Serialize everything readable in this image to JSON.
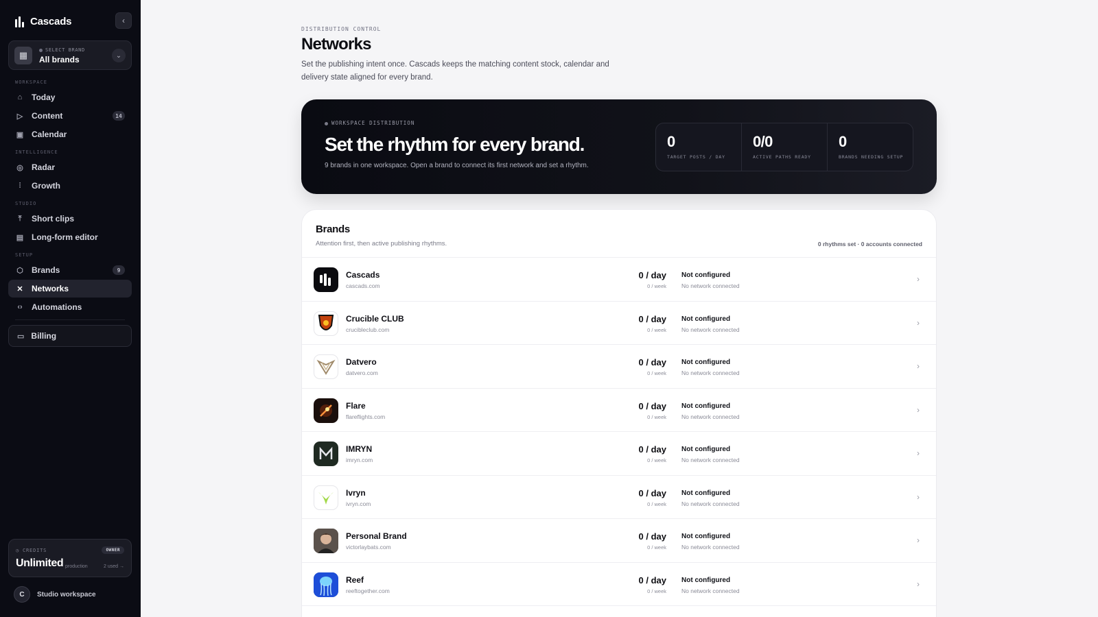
{
  "app": {
    "name": "Cascads"
  },
  "sidebar": {
    "collapse_icon": "chevron-left-icon",
    "brand_select": {
      "label": "SELECT BRAND",
      "value": "All brands"
    },
    "sections": {
      "workspace": "WORKSPACE",
      "intelligence": "INTELLIGENCE",
      "studio": "STUDIO",
      "setup": "SETUP"
    },
    "items": [
      {
        "label": "Today",
        "icon": "home-icon"
      },
      {
        "label": "Content",
        "icon": "play-square-icon",
        "badge": "14"
      },
      {
        "label": "Calendar",
        "icon": "calendar-icon"
      },
      {
        "label": "Radar",
        "icon": "radar-icon"
      },
      {
        "label": "Growth",
        "icon": "chart-icon"
      },
      {
        "label": "Short clips",
        "icon": "upload-icon"
      },
      {
        "label": "Long-form editor",
        "icon": "film-icon"
      },
      {
        "label": "Brands",
        "icon": "box-icon",
        "badge": "9"
      },
      {
        "label": "Networks",
        "icon": "network-icon",
        "active": true
      },
      {
        "label": "Automations",
        "icon": "code-icon"
      }
    ],
    "billing": {
      "label": "Billing",
      "icon": "card-icon"
    },
    "credits": {
      "label": "CREDITS",
      "role": "OWNER",
      "value": "Unlimited",
      "env": "production",
      "used": "2 used →"
    },
    "workspace": {
      "initial": "C",
      "name": "Studio workspace"
    }
  },
  "header": {
    "eyebrow": "DISTRIBUTION CONTROL",
    "title": "Networks",
    "description": "Set the publishing intent once. Cascads keeps the matching content stock, calendar and delivery state aligned for every brand."
  },
  "hero": {
    "eyebrow": "WORKSPACE DISTRIBUTION",
    "title": "Set the rhythm for every brand.",
    "subtitle": "9 brands in one workspace. Open a brand to connect its first network and set a rhythm.",
    "stats": [
      {
        "value": "0",
        "label": "TARGET POSTS / DAY"
      },
      {
        "value": "0/0",
        "label": "ACTIVE PATHS READY"
      },
      {
        "value": "0",
        "label": "BRANDS NEEDING SETUP"
      }
    ]
  },
  "brands": {
    "title": "Brands",
    "subtitle": "Attention first, then active publishing rhythms.",
    "summary": "0 rhythms set · 0 accounts connected",
    "rows": [
      {
        "name": "Cascads",
        "domain": "cascads.com",
        "rate": "0 / day",
        "week": "0 / week",
        "status": "Not configured",
        "network": "No network connected",
        "logo_color": "#0b0b0f"
      },
      {
        "name": "Crucible CLUB",
        "domain": "crucibleclub.com",
        "rate": "0 / day",
        "week": "0 / week",
        "status": "Not configured",
        "network": "No network connected",
        "logo_color": "#c2410c"
      },
      {
        "name": "Datvero",
        "domain": "datvero.com",
        "rate": "0 / day",
        "week": "0 / week",
        "status": "Not configured",
        "network": "No network connected",
        "logo_color": "#a08a6a"
      },
      {
        "name": "Flare",
        "domain": "flareflights.com",
        "rate": "0 / day",
        "week": "0 / week",
        "status": "Not configured",
        "network": "No network connected",
        "logo_color": "#1a0f0c"
      },
      {
        "name": "IMRYN",
        "domain": "imryn.com",
        "rate": "0 / day",
        "week": "0 / week",
        "status": "Not configured",
        "network": "No network connected",
        "logo_color": "#1f2a22"
      },
      {
        "name": "Ivryn",
        "domain": "ivryn.com",
        "rate": "0 / day",
        "week": "0 / week",
        "status": "Not configured",
        "network": "No network connected",
        "logo_color": "#9acd32"
      },
      {
        "name": "Personal Brand",
        "domain": "victorlaybats.com",
        "rate": "0 / day",
        "week": "0 / week",
        "status": "Not configured",
        "network": "No network connected",
        "logo_color": "#6b4f3f"
      },
      {
        "name": "Reef",
        "domain": "reeftogether.com",
        "rate": "0 / day",
        "week": "0 / week",
        "status": "Not configured",
        "network": "No network connected",
        "logo_color": "#1d6fe0"
      }
    ]
  }
}
